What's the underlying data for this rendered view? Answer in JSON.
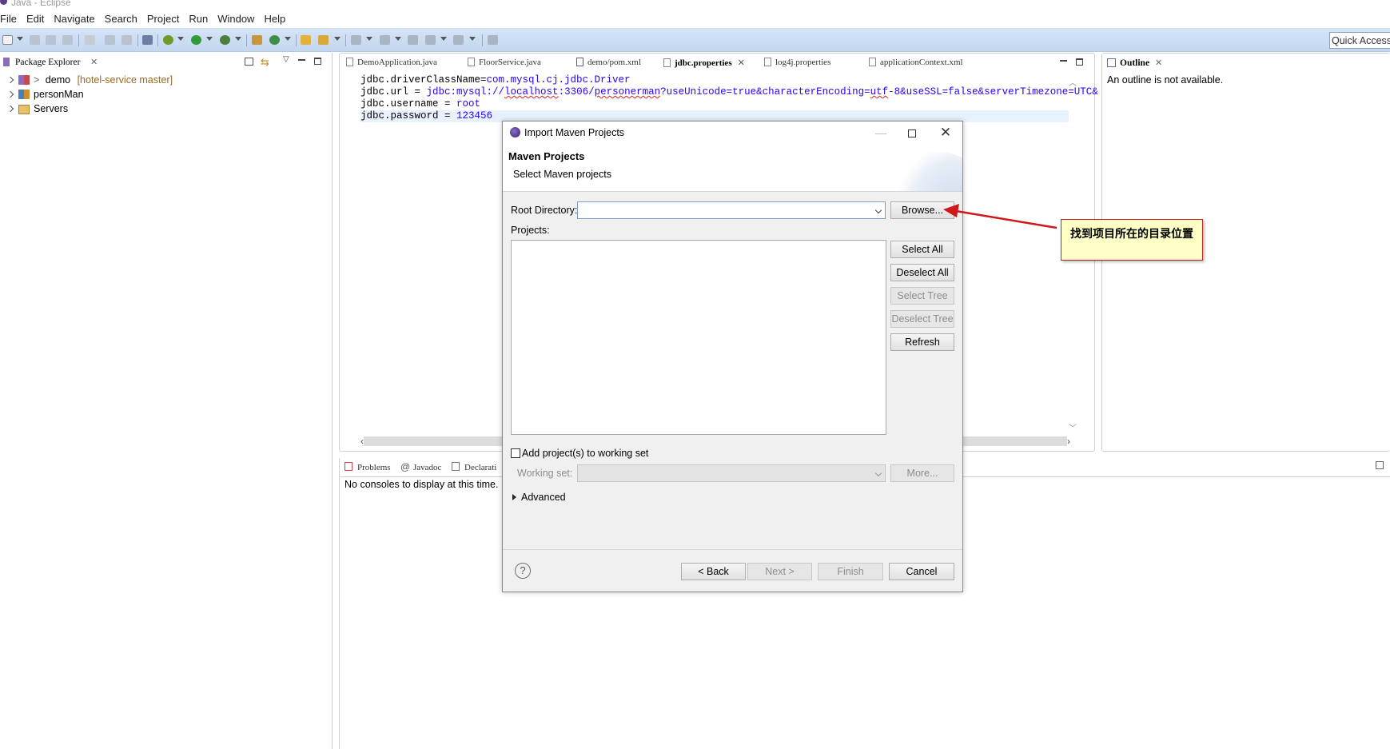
{
  "window": {
    "title": "Java - Eclipse"
  },
  "menu": [
    "File",
    "Edit",
    "Navigate",
    "Search",
    "Project",
    "Run",
    "Window",
    "Help"
  ],
  "toolbar": {
    "quick_access": "Quick Access"
  },
  "package_explorer": {
    "title": "Package Explorer",
    "items": [
      {
        "prefix": ">",
        "name": "demo",
        "decoration": "[hotel-service master]"
      },
      {
        "name": "personMan"
      },
      {
        "name": "Servers"
      }
    ]
  },
  "editor": {
    "tabs": [
      {
        "label": "DemoApplication.java"
      },
      {
        "label": "FloorService.java"
      },
      {
        "label": "demo/pom.xml"
      },
      {
        "label": "jdbc.properties"
      },
      {
        "label": "log4j.properties"
      },
      {
        "label": "applicationContext.xml"
      }
    ],
    "lines": [
      {
        "key": "jdbc.driverClassName=",
        "value": "com.mysql.cj.jdbc.Driver"
      },
      {
        "key": "jdbc.url = ",
        "value": "jdbc:mysql://localhost:3306/personerman?useUnicode=true&characterEncoding=utf-8&useSSL=false&serverTimezone=UTC&"
      },
      {
        "key": "jdbc.username = ",
        "value": "root"
      },
      {
        "key": "jdbc.password = ",
        "value": "123456"
      }
    ]
  },
  "outline": {
    "title": "Outline",
    "message": "An outline is not available."
  },
  "console": {
    "tabs": [
      "Problems",
      "Javadoc",
      "Declarati"
    ],
    "message": "No consoles to display at this time."
  },
  "dialog": {
    "title": "Import Maven Projects",
    "heading": "Maven Projects",
    "subheading": "Select Maven projects",
    "root_directory_label": "Root Directory:",
    "root_directory_value": "",
    "browse": "Browse...",
    "projects_label": "Projects:",
    "select_all": "Select All",
    "deselect_all": "Deselect All",
    "select_tree": "Select Tree",
    "deselect_tree": "Deselect Tree",
    "refresh": "Refresh",
    "add_working_set": "Add project(s) to working set",
    "working_set_label": "Working set:",
    "more": "More...",
    "advanced": "Advanced",
    "help": "?",
    "back": "< Back",
    "next": "Next >",
    "finish": "Finish",
    "cancel": "Cancel"
  },
  "annotation": {
    "text": "找到项目所在的目录位置"
  }
}
